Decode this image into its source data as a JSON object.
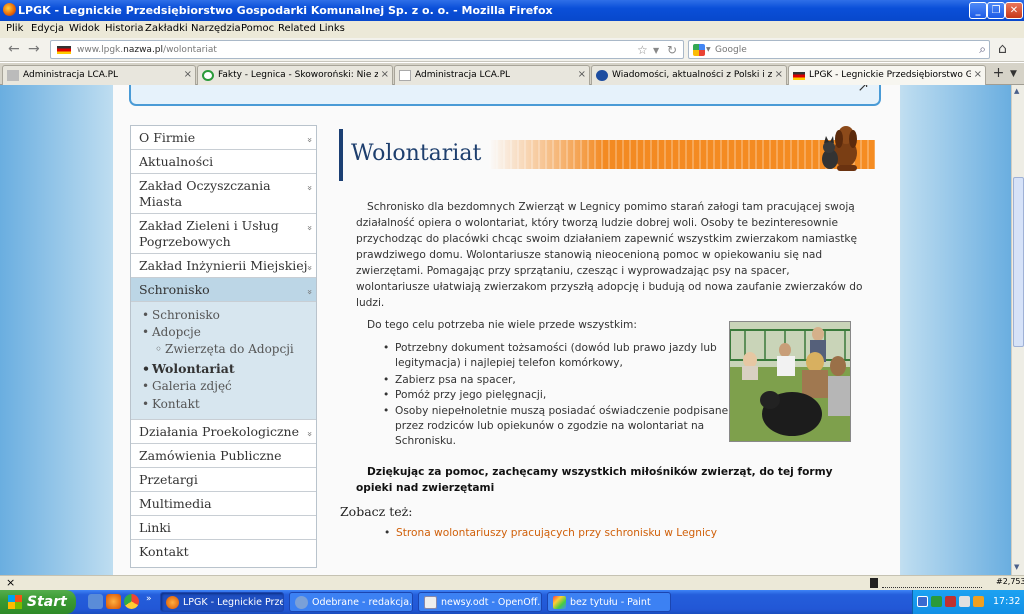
{
  "window": {
    "title": "LPGK - Legnickie Przedsiębiorstwo Gospodarki Komunalnej Sp. z o. o. - Mozilla Firefox",
    "controls": [
      "_",
      "❐",
      "✕"
    ]
  },
  "menubar": [
    "Plik",
    "Edycja",
    "Widok",
    "Historia",
    "Zakładki",
    "Narzędzia",
    "Pomoc",
    "Related Links"
  ],
  "navbar": {
    "url_prefix": "www.lpgk.",
    "url_domain": "nazwa.pl",
    "url_path": "/wolontariat",
    "search_placeholder": "Google"
  },
  "tabs": [
    {
      "label": "Administracja LCA.PL"
    },
    {
      "label": "Fakty - Legnica - Skoworoński: Nie zmieni..."
    },
    {
      "label": "Administracja LCA.PL"
    },
    {
      "label": "Wiadomości, aktualności z Polski i ze Świ..."
    },
    {
      "label": "LPGK - Legnickie Przedsiębiorstwo Gospo..."
    }
  ],
  "sidebar": {
    "items": [
      {
        "label": "O Firmie",
        "chevron": true
      },
      {
        "label": "Aktualności",
        "chevron": false
      },
      {
        "label": "Zakład Oczyszczania Miasta",
        "chevron": true
      },
      {
        "label": "Zakład Zieleni i Usług Pogrzebowych",
        "chevron": true
      },
      {
        "label": "Zakład Inżynierii Miejskiej",
        "chevron": true
      },
      {
        "label": "Schronisko",
        "chevron": true
      },
      {
        "label": "Działania Proekologiczne",
        "chevron": true
      },
      {
        "label": "Zamówienia Publiczne",
        "chevron": false
      },
      {
        "label": "Przetargi",
        "chevron": false
      },
      {
        "label": "Multimedia",
        "chevron": false
      },
      {
        "label": "Linki",
        "chevron": false
      },
      {
        "label": "Kontakt",
        "chevron": false
      }
    ],
    "submenu": [
      {
        "label": "Schronisko"
      },
      {
        "label": "Adopcje"
      },
      {
        "label": "Zwierzęta do Adopcji"
      },
      {
        "label": "Wolontariat"
      },
      {
        "label": "Galeria zdjęć"
      },
      {
        "label": "Kontakt"
      }
    ],
    "chevron_glyph": "»"
  },
  "content": {
    "title": "Wolontariat",
    "intro_lines": [
      "Schronisko dla bezdomnych Zwierząt w Legnicy pomimo starań załogi tam pracującej swoją",
      "działalność opiera o wolontariat, który tworzą ludzie dobrej woli. Osoby te bezinteresownie",
      "przychodząc do placówki chcąc swoim działaniem zapewnić wszystkim zwierzakom namiastkę",
      "prawdziwego domu. Wolontariusze stanowią nieocenioną pomoc w opiekowaniu się nad",
      "zwierzętami. Pomagając przy sprzątaniu, czesząc i wyprowadzając psy na spacer,",
      "wolontariusze ułatwiają zwierzakom przyszłą adopcję i budują od nowa zaufanie zwierzaków do",
      "ludzi."
    ],
    "needs_intro": "Do tego celu potrzeba nie wiele przede wszystkim:",
    "requirements": [
      [
        "Potrzebny dokument tożsamości (dowód lub prawo jazdy lub",
        "legitymacja) i najlepiej telefon komórkowy,"
      ],
      [
        "Zabierz psa na spacer,"
      ],
      [
        "Pomóż przy jego pielęgnacji,"
      ],
      [
        "Osoby niepełnoletnie muszą posiadać oświadczenie podpisane",
        "przez rodziców lub opiekunów o zgodzie na wolontariat na",
        "Schronisku."
      ]
    ],
    "thanks_lines": [
      "Dziękując za pomoc, zachęcamy wszystkich miłośników zwierząt, do tej formy",
      "opieki nad zwierzętami"
    ],
    "see_also": "Zobacz też:",
    "see_also_link": "Strona wolontariuszy pracujących przy schronisku w Legnicy"
  },
  "statusbar": {
    "close": "×",
    "counter": "#2,753"
  },
  "taskbar": {
    "start": "Start",
    "tasks": [
      {
        "label": "LPGK - Legnickie Prze...",
        "active": true
      },
      {
        "label": "Odebrane - redakcja...",
        "active": false
      },
      {
        "label": "newsy.odt - OpenOff...",
        "active": false
      },
      {
        "label": "bez tytułu - Paint",
        "active": false
      }
    ],
    "clock": "17:32"
  },
  "colors": {
    "accent_orange": "#f38a22",
    "title_blue": "#1e3f6e",
    "link_orange": "#d0600a",
    "submenu_bg": "#d7e6ef"
  }
}
